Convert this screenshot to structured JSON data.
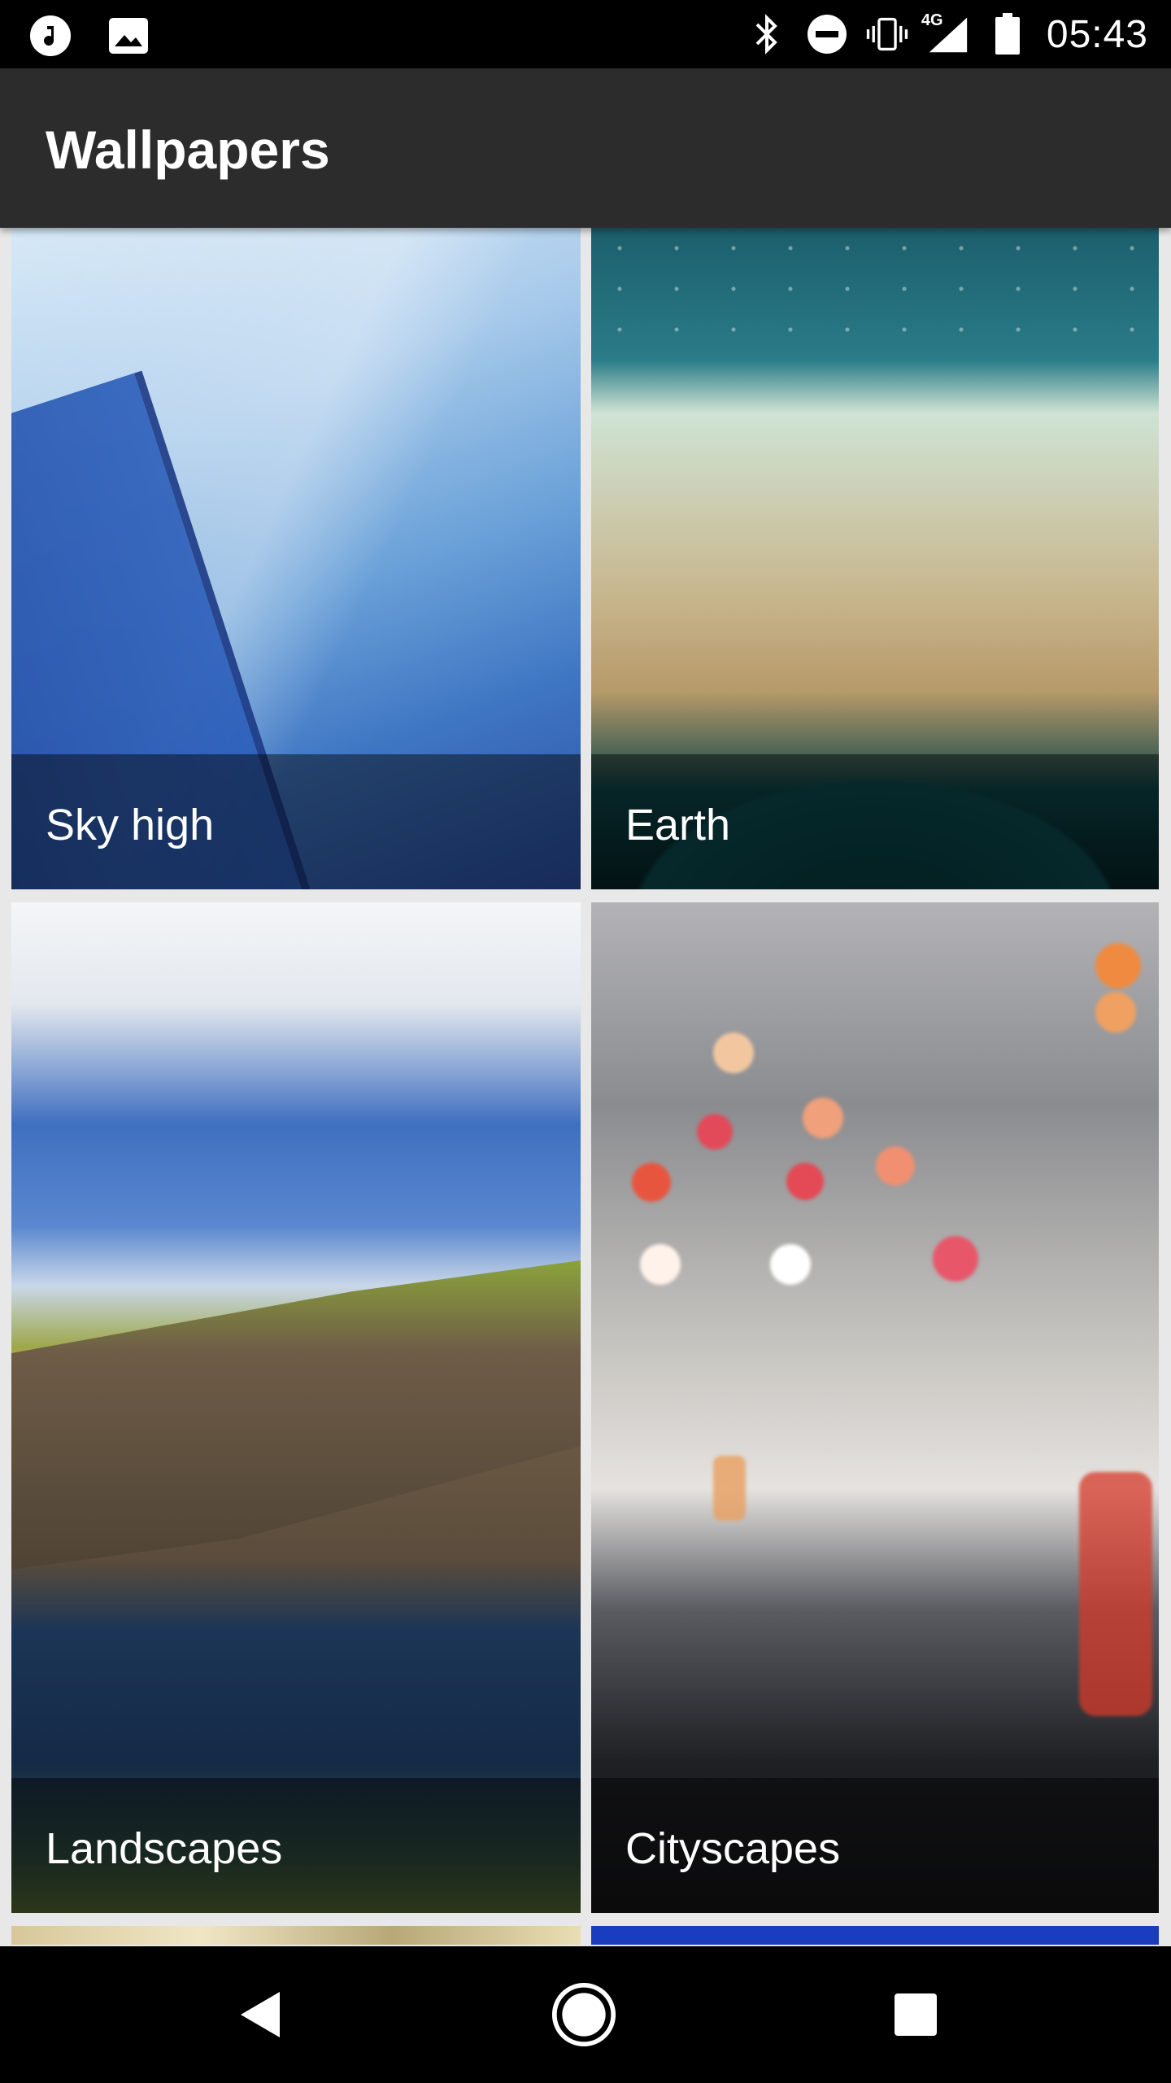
{
  "status_bar": {
    "time": "05:43",
    "network": "4G",
    "left_icons": [
      "music-note-icon",
      "image-icon"
    ],
    "right_icons": [
      "bluetooth-icon",
      "do-not-disturb-icon",
      "vibrate-icon",
      "signal-4g-icon",
      "battery-icon"
    ]
  },
  "app_bar": {
    "title": "Wallpapers"
  },
  "categories": [
    {
      "label": "Sky high"
    },
    {
      "label": "Earth"
    },
    {
      "label": "Landscapes"
    },
    {
      "label": "Cityscapes"
    }
  ],
  "nav_bar": {
    "icons": [
      "back-icon",
      "home-icon",
      "recents-icon"
    ]
  },
  "colors": {
    "status_bar_bg": "#000000",
    "app_bar_bg": "#2c2c2c",
    "background": "#e8e8e8",
    "caption_overlay": "rgba(0,0,0,0.45)"
  }
}
